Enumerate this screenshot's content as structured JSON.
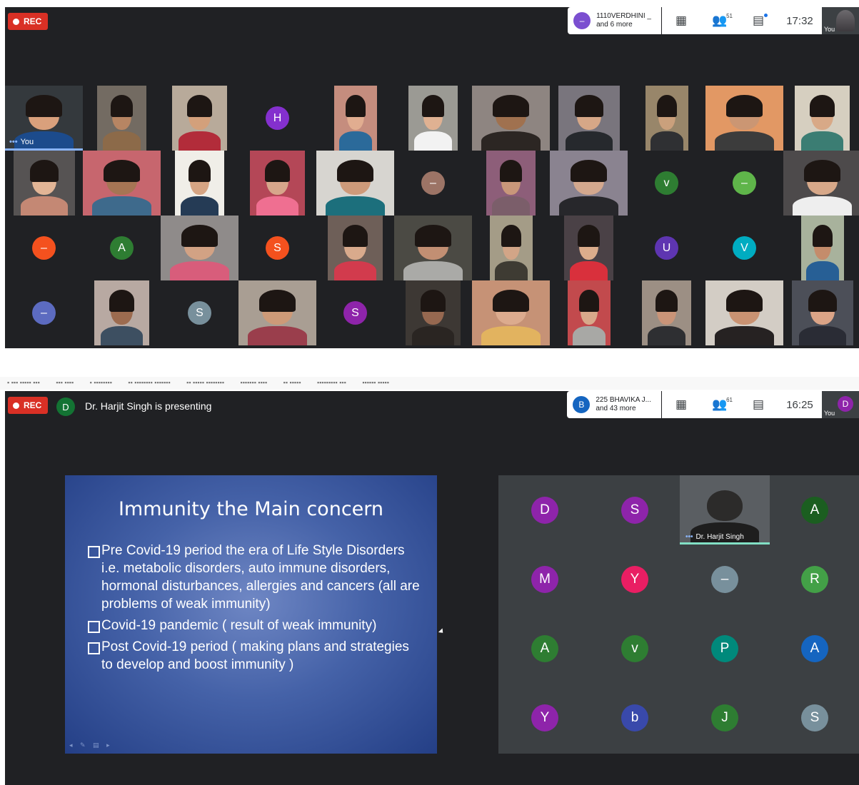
{
  "shot1": {
    "rec_label": "REC",
    "people_pill": {
      "avatar": "–",
      "avatar_color": "#7b4fd0",
      "line1": "1110VERDHINI _",
      "line2": "and 6 more"
    },
    "participants_count": "51",
    "time": "17:32",
    "self_label": "You",
    "self_tile_label": "You",
    "tiles": [
      {
        "kind": "photo",
        "bg": "#34393d",
        "skin": "#d9a07c",
        "shirt": "#1c4b8c",
        "label": "You"
      },
      {
        "kind": "photo",
        "bg": "#736b62",
        "skin": "#b78563",
        "shirt": "#8c6a49"
      },
      {
        "kind": "photo",
        "bg": "#b8aa9a",
        "skin": "#d3a07b",
        "shirt": "#b22c3a"
      },
      {
        "kind": "letter",
        "letter": "H",
        "color": "#8430ce"
      },
      {
        "kind": "photo",
        "bg": "#c58d7e",
        "skin": "#e1ad90",
        "shirt": "#2b6a9a"
      },
      {
        "kind": "photo",
        "bg": "#9b9a94",
        "skin": "#dfb192",
        "shirt": "#f2f2f2"
      },
      {
        "kind": "photo",
        "bg": "#8e8581",
        "skin": "#a0714f",
        "shirt": "#2c2623"
      },
      {
        "kind": "photo",
        "bg": "#79757d",
        "skin": "#d6a787",
        "shirt": "#26292d"
      },
      {
        "kind": "photo",
        "bg": "#98866a",
        "skin": "#caa07c",
        "shirt": "#2f3033"
      },
      {
        "kind": "photo",
        "bg": "#e29864",
        "skin": "#cb9673",
        "shirt": "#3c3c3c"
      },
      {
        "kind": "photo",
        "bg": "#d6cfc0",
        "skin": "#d8a987",
        "shirt": "#3b7d73"
      },
      {
        "kind": "photo",
        "bg": "#565353",
        "skin": "#e2b596",
        "shirt": "#c48874"
      },
      {
        "kind": "photo",
        "bg": "#c7666e",
        "skin": "#a67554",
        "shirt": "#3e6a8c"
      },
      {
        "kind": "photo",
        "bg": "#f0eee8",
        "skin": "#d5a483",
        "shirt": "#253b55"
      },
      {
        "kind": "photo",
        "bg": "#b44757",
        "skin": "#d7a68b",
        "shirt": "#ef6f91"
      },
      {
        "kind": "photo",
        "bg": "#d7d5d0",
        "skin": "#cd9a7a",
        "shirt": "#1c6f7c"
      },
      {
        "kind": "letter",
        "letter": "–",
        "color": "#9c7466"
      },
      {
        "kind": "photo",
        "bg": "#8d5e79",
        "skin": "#c9977a",
        "shirt": "#7b5e6a"
      },
      {
        "kind": "photo",
        "bg": "#8a8390",
        "skin": "#d3a88e",
        "shirt": "#27272b"
      },
      {
        "kind": "letter",
        "letter": "v",
        "color": "#2e7d32"
      },
      {
        "kind": "letter",
        "letter": "–",
        "color": "#5fb54a"
      },
      {
        "kind": "photo",
        "bg": "#4d4a4b",
        "skin": "#d7a889",
        "shirt": "#eeeeee"
      },
      {
        "kind": "letter",
        "letter": "–",
        "color": "#f4511e"
      },
      {
        "kind": "letter",
        "letter": "A",
        "color": "#2e7d32"
      },
      {
        "kind": "photo",
        "bg": "#8f8b8a",
        "skin": "#d2a284",
        "shirt": "#d85d7b"
      },
      {
        "kind": "letter",
        "letter": "S",
        "color": "#f4511e"
      },
      {
        "kind": "photo",
        "bg": "#6e5f58",
        "skin": "#d9aa8c",
        "shirt": "#d23b4d"
      },
      {
        "kind": "photo",
        "bg": "#4b4a44",
        "skin": "#c28f73",
        "shirt": "#aaaaa7"
      },
      {
        "kind": "photo",
        "bg": "#a49c87",
        "skin": "#d2a587",
        "shirt": "#3e3b33"
      },
      {
        "kind": "photo",
        "bg": "#4a4146",
        "skin": "#dcad8c",
        "shirt": "#d9303c"
      },
      {
        "kind": "letter",
        "letter": "U",
        "color": "#5e35b1"
      },
      {
        "kind": "letter",
        "letter": "V",
        "color": "#00acc1"
      },
      {
        "kind": "photo",
        "bg": "#a8b29c",
        "skin": "#c48c6b",
        "shirt": "#275f95"
      },
      {
        "kind": "letter",
        "letter": "–",
        "color": "#5c6bc0"
      },
      {
        "kind": "photo",
        "bg": "#b8a9a2",
        "skin": "#9c6b4f",
        "shirt": "#3d4f61"
      },
      {
        "kind": "letter",
        "letter": "S",
        "color": "#78909c"
      },
      {
        "kind": "photo",
        "bg": "#a99e93",
        "skin": "#cd9a78",
        "shirt": "#9a3e4c"
      },
      {
        "kind": "letter",
        "letter": "S",
        "color": "#8e24aa"
      },
      {
        "kind": "photo",
        "bg": "#3d3834",
        "skin": "#966850",
        "shirt": "#2a2522"
      },
      {
        "kind": "photo",
        "bg": "#c69276",
        "skin": "#dcab8e",
        "shirt": "#e2b35f"
      },
      {
        "kind": "photo",
        "bg": "#c24a4d",
        "skin": "#d8a98b",
        "shirt": "#a8a8a5"
      },
      {
        "kind": "photo",
        "bg": "#9c8f84",
        "skin": "#c99478",
        "shirt": "#2e2f32"
      },
      {
        "kind": "photo",
        "bg": "#d3cdc5",
        "skin": "#c99272",
        "shirt": "#262222"
      },
      {
        "kind": "photo",
        "bg": "#4c4f58",
        "skin": "#dba487",
        "shirt": "#2a2c35"
      }
    ]
  },
  "shot2": {
    "rec_label": "REC",
    "presenter_initial": "D",
    "presenting_text": "Dr. Harjit Singh is presenting",
    "people_pill": {
      "avatar": "B",
      "avatar_color": "#1565c0",
      "line1": "225 BHAVIKA J...",
      "line2": "and 43 more"
    },
    "participants_count": "61",
    "time": "16:25",
    "self_label": "You",
    "self_initial": "D",
    "self_color": "#8e24aa",
    "slide": {
      "title": "Immunity  the Main concern",
      "bullets": [
        "Pre Covid-19 period the era of Life Style Disorders i.e. metabolic disorders, auto immune disorders, hormonal disturbances, allergies and cancers (all are problems of weak immunity)",
        "Covid-19 pandemic ( result of weak immunity)",
        "Post Covid-19 period ( making plans and strategies to develop and boost immunity )"
      ]
    },
    "presenter_tile_name": "Dr. Harjit Singh",
    "participants": [
      {
        "letter": "D",
        "color": "#8e24aa"
      },
      {
        "letter": "S",
        "color": "#8e24aa"
      },
      {
        "letter": "",
        "color": "",
        "presenter": true
      },
      {
        "letter": "A",
        "color": "#1b5e20"
      },
      {
        "letter": "M",
        "color": "#8e24aa"
      },
      {
        "letter": "Y",
        "color": "#e91e63"
      },
      {
        "letter": "–",
        "color": "#78909c"
      },
      {
        "letter": "R",
        "color": "#43a047"
      },
      {
        "letter": "A",
        "color": "#2e7d32"
      },
      {
        "letter": "v",
        "color": "#2e7d32"
      },
      {
        "letter": "P",
        "color": "#00897b"
      },
      {
        "letter": "A",
        "color": "#1565c0"
      },
      {
        "letter": "Y",
        "color": "#8e24aa"
      },
      {
        "letter": "b",
        "color": "#3949ab"
      },
      {
        "letter": "J",
        "color": "#2e7d32"
      },
      {
        "letter": "S",
        "color": "#78909c"
      }
    ]
  }
}
